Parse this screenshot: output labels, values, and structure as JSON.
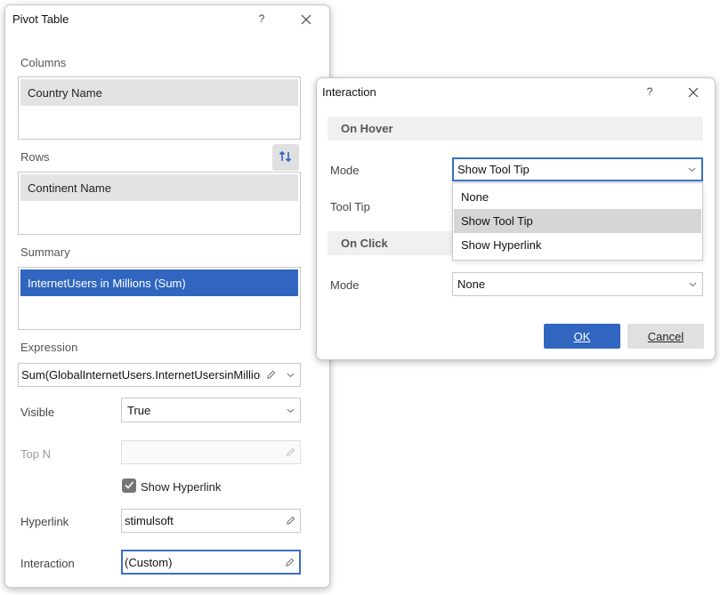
{
  "pivot_dialog": {
    "title": "Pivot Table",
    "help": "?",
    "columns_label": "Columns",
    "columns_items": [
      "Country Name"
    ],
    "rows_label": "Rows",
    "rows_items": [
      "Continent Name"
    ],
    "summary_label": "Summary",
    "summary_items": [
      "InternetUsers in Millions (Sum)"
    ],
    "expression_label": "Expression",
    "expression_value": "Sum(GlobalInternetUsers.InternetUsersinMillions)",
    "visible_label": "Visible",
    "visible_value": "True",
    "topn_label": "Top N",
    "topn_value": "",
    "show_hyperlink_label": "Show Hyperlink",
    "show_hyperlink_checked": true,
    "hyperlink_label": "Hyperlink",
    "hyperlink_value": "stimulsoft",
    "interaction_label": "Interaction",
    "interaction_value": "(Custom)"
  },
  "interaction_dialog": {
    "title": "Interaction",
    "help": "?",
    "on_hover_header": "On Hover",
    "hover_mode_label": "Mode",
    "hover_mode_value": "Show Tool Tip",
    "tooltip_label": "Tool Tip",
    "on_click_header": "On Click",
    "click_mode_label": "Mode",
    "click_mode_value": "None",
    "mode_options": [
      "None",
      "Show Tool Tip",
      "Show Hyperlink"
    ],
    "highlighted_option": "Show Tool Tip",
    "ok_label": "OK",
    "cancel_label": "Cancel"
  },
  "colors": {
    "accent": "#3066c0",
    "focus_border": "#3a6fc4",
    "list_item_bg": "#e3e3e3",
    "swap_icon": "#2a64c8"
  },
  "icons": {
    "close": "close-icon",
    "chevron": "chevron-down-icon",
    "edit": "pencil-icon",
    "swap": "swap-arrows-icon",
    "check": "checkmark-icon"
  }
}
